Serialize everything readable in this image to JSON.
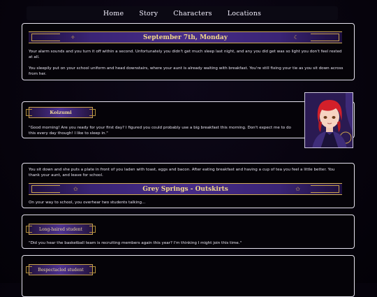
{
  "nav": {
    "items": [
      "Home",
      "Story",
      "Characters",
      "Locations"
    ]
  },
  "scene1": {
    "banner_title": "September 7th, Monday",
    "paragraphs": [
      "Your alarm sounds and you turn it off within a second. Unfortunately you didn't get much sleep last night, and any you did get was so light you don't feel rested at all.",
      "You sleepily put on your school uniform and head downstairs, where your aunt is already waiting with breakfast. You're still fixing your tie as you sit down across from her."
    ]
  },
  "dialogue1": {
    "speaker": "Koizumi",
    "text": "\"Good morning! Are you ready for your first day? I figured you could probably use a big breakfast this morning. Don't expect me to do this every day though! I like to sleep in.\""
  },
  "scene2": {
    "paragraph": "You sit down and she puts a plate in front of you laden with toast, eggs and bacon. After eating breakfast and having a cup of tea you feel a little better. You thank your aunt, and leave for school.",
    "banner_title": "Grey Springs - Outskirts",
    "paragraph2": "On your way to school, you overhear two students talking..."
  },
  "dialogue2": {
    "speaker": "Long-haired student",
    "text": "\"Did you hear the basketball team is recruiting members again this year? I'm thinking I might join this time.\""
  },
  "dialogue3": {
    "speaker": "Bespectacled student"
  },
  "colors": {
    "accent_gold": "#d1ad56",
    "banner_purple": "#462b88",
    "background": "#06030c"
  }
}
